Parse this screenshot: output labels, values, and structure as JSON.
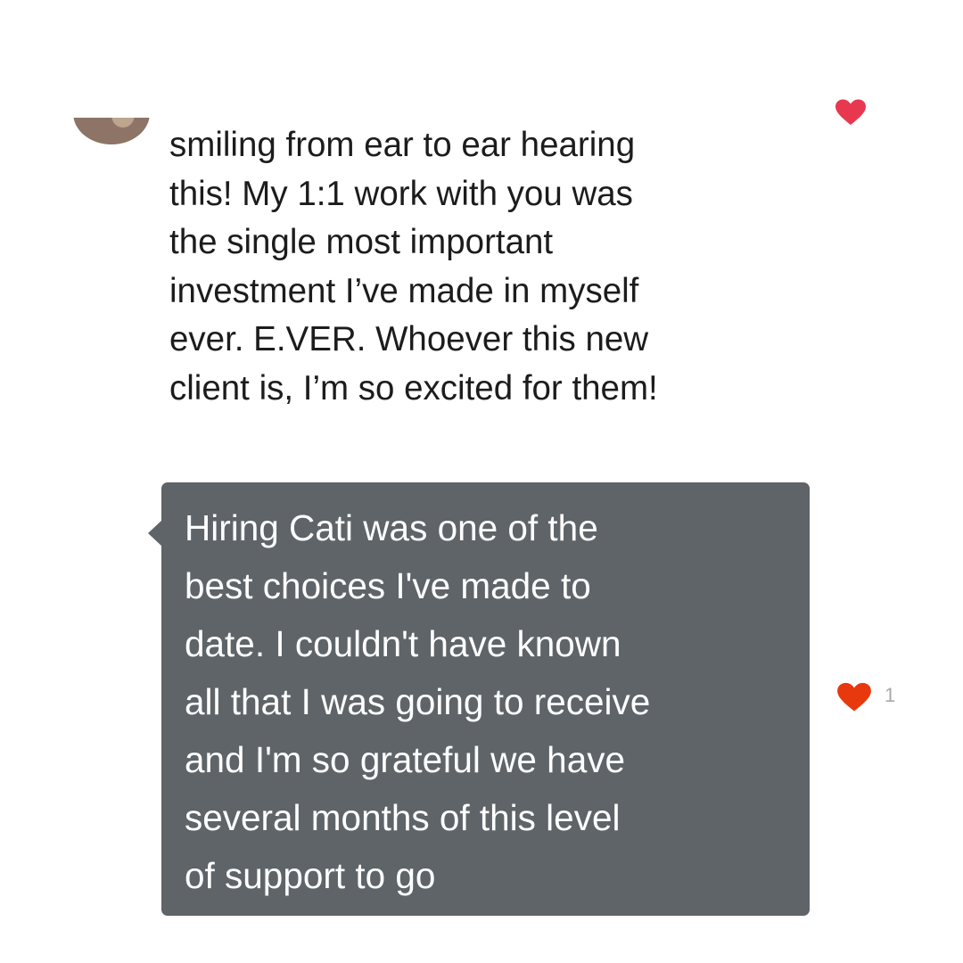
{
  "comment_1": {
    "text": "smiling from ear to ear hearing\nthis! My 1:1 work with you was\nthe single most important\ninvestment I’ve made in myself\never. E.VER. Whoever this new\nclient is, I’m so excited for them!",
    "liked": true,
    "heart_color": "#e8384f"
  },
  "comment_2": {
    "text": "Hiring Cati was one of the\nbest choices I've made to\ndate. I couldn't have known\nall that I was going to receive\nand I'm so grateful we have\nseveral months of this level\nof support to go",
    "bubble_color": "#5e6468",
    "heart_color": "#e8380d",
    "like_count": "1"
  },
  "icons": {
    "heart_top": "heart-icon",
    "heart_bottom": "heart-icon"
  }
}
